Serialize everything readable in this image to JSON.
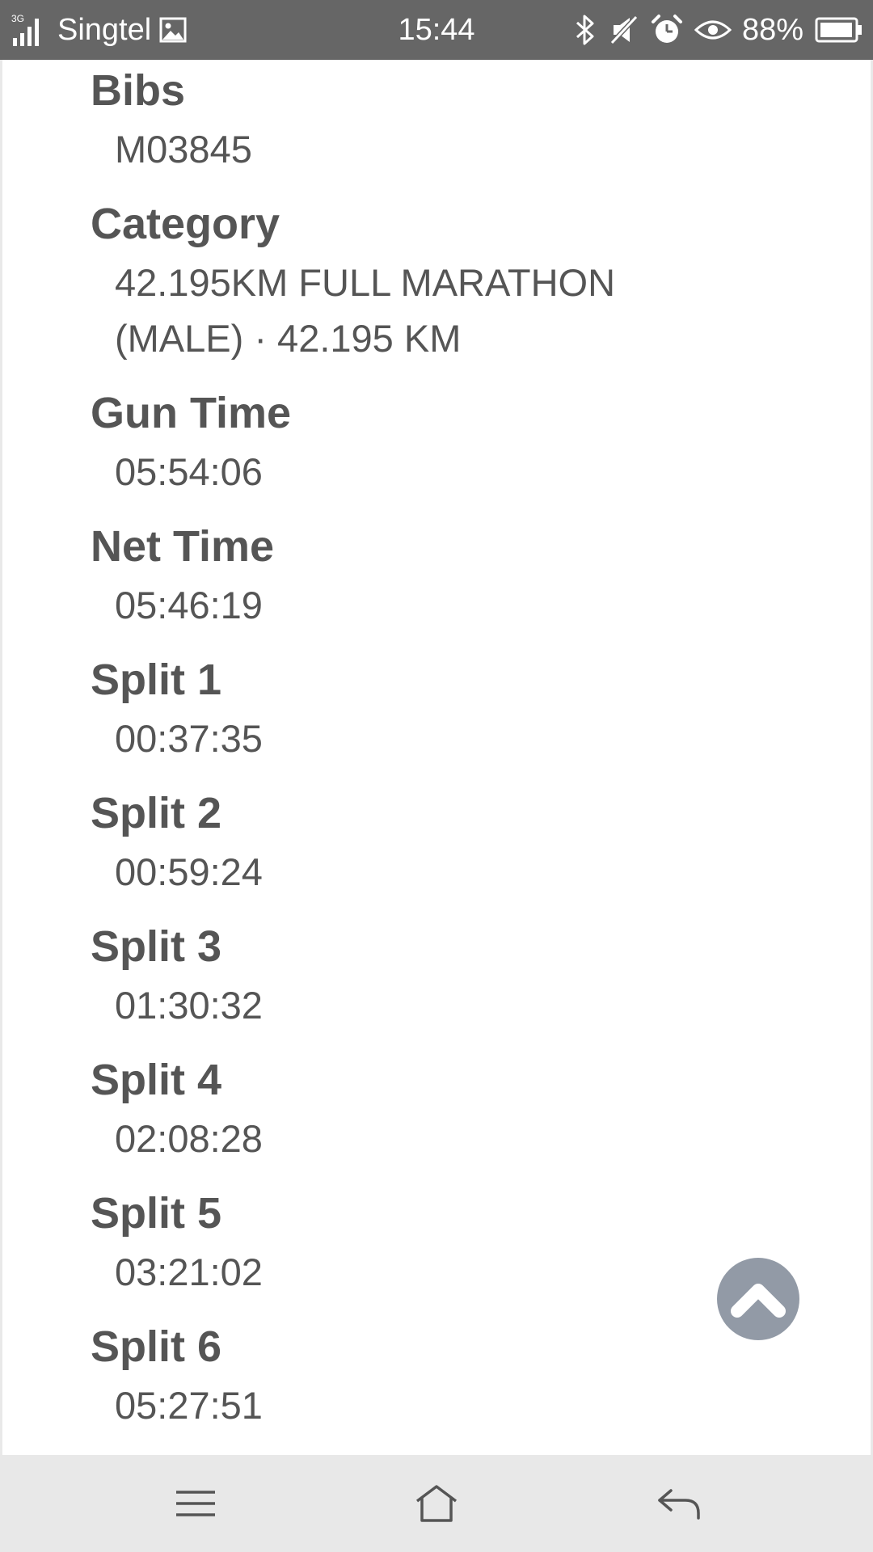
{
  "status_bar": {
    "network": "3G",
    "carrier": "Singtel",
    "time": "15:44",
    "battery": "88%",
    "icons": [
      "signal-icon",
      "image-icon",
      "bluetooth-icon",
      "mute-icon",
      "alarm-icon",
      "eye-icon",
      "battery-icon"
    ]
  },
  "result": {
    "fields": [
      {
        "label": "Bibs",
        "value": "M03845"
      },
      {
        "label": "Category",
        "value_line1": "42.195KM FULL MARATHON",
        "value_line2": "(MALE) · 42.195 KM"
      },
      {
        "label": "Gun Time",
        "value": "05:54:06"
      },
      {
        "label": "Net Time",
        "value": "05:46:19"
      },
      {
        "label": "Split 1",
        "value": "00:37:35"
      },
      {
        "label": "Split 2",
        "value": "00:59:24"
      },
      {
        "label": "Split 3",
        "value": "01:30:32"
      },
      {
        "label": "Split 4",
        "value": "02:08:28"
      },
      {
        "label": "Split 5",
        "value": "03:21:02"
      },
      {
        "label": "Split 6",
        "value": "05:27:51"
      }
    ]
  },
  "scroll_top": {
    "icon": "chevron-up-icon",
    "color": "#929aa6"
  },
  "nav_bar": {
    "icons": [
      "menu-icon",
      "home-icon",
      "back-icon"
    ]
  },
  "colors": {
    "status_bar": "#666666",
    "text": "#555555",
    "nav_bar": "#e8e8e8"
  }
}
